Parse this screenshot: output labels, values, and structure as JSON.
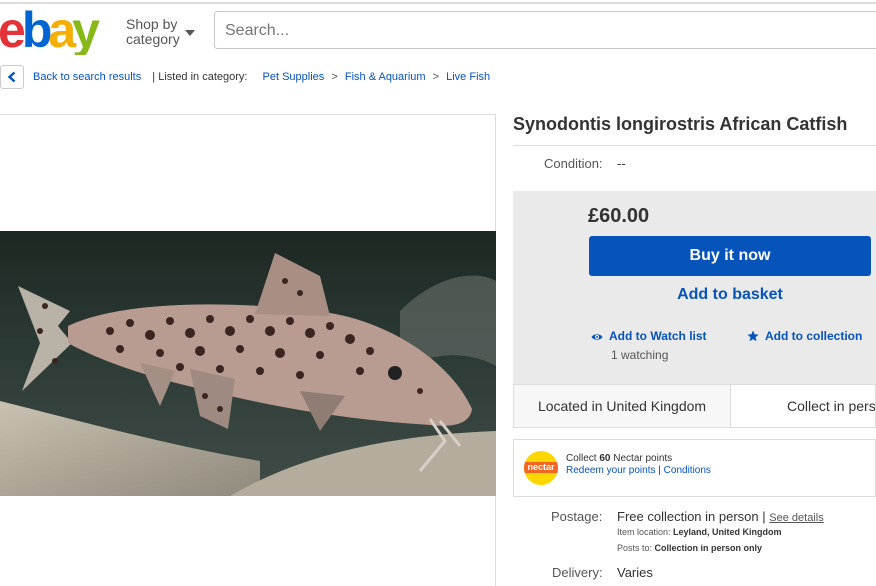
{
  "header": {
    "shop_by_line1": "Shop by",
    "shop_by_line2": "category",
    "search_placeholder": "Search..."
  },
  "breadcrumb": {
    "back": "Back to search results",
    "listed_in": "| Listed in category:",
    "items": [
      "Pet Supplies",
      "Fish & Aquarium",
      "Live Fish"
    ],
    "separator": ">"
  },
  "listing": {
    "title": "Synodontis longirostris African Catfish",
    "condition_label": "Condition:",
    "condition_value": "--",
    "price": "£60.00",
    "buy_now": "Buy it now",
    "add_to_basket": "Add to basket",
    "watch_list": "Add to Watch list",
    "watching": "1 watching",
    "add_to_collection": "Add to collection",
    "located": "Located in United Kingdom",
    "collect_in_person": "Collect in person"
  },
  "nectar": {
    "logo_text": "nectar",
    "collect_prefix": "Collect",
    "points": "60",
    "collect_suffix": "Nectar points",
    "redeem": "Redeem your points",
    "divider": "|",
    "conditions": "Conditions"
  },
  "postage": {
    "label": "Postage:",
    "value": "Free collection in person",
    "divider": "|",
    "see_details": "See details",
    "item_location_label": "Item location:",
    "item_location_value": "Leyland, United Kingdom",
    "posts_to_label": "Posts to:",
    "posts_to_value": "Collection in person only",
    "delivery_label": "Delivery:",
    "delivery_value": "Varies"
  },
  "colors": {
    "link_blue": "#0654ba",
    "buy_button": "#0654ba",
    "buybox_bg": "#eaeaea"
  },
  "icons": [
    "ebay-logo",
    "chevron-left-icon",
    "eye-icon",
    "star-icon",
    "nectar-logo",
    "caret-down-icon"
  ]
}
